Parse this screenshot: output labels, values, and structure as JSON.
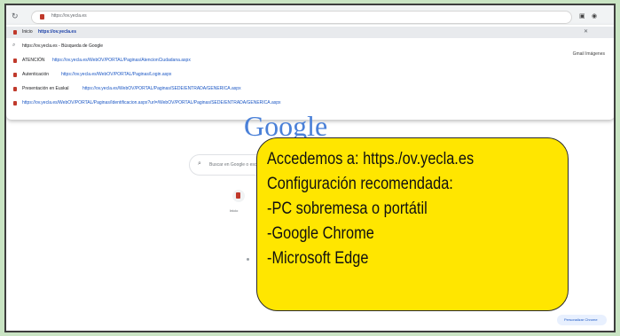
{
  "colors": {
    "background": "#c9e4c3",
    "callout_fill": "#ffe600",
    "link_blue": "#1a56c4",
    "favicon_red": "#c0392b"
  },
  "browser": {
    "omnibox_text": "https://ov.yecla.es",
    "refresh_icon": "refresh-icon"
  },
  "dropdown": {
    "rows": [
      {
        "title": "Inicio",
        "url": "https://ov.yecla.es",
        "selected": true
      },
      {
        "title": "https://ov.yecla.es - Búsqueda de Google",
        "url": "",
        "selected": false,
        "icon": "search-icon"
      },
      {
        "title": "ATENCIÓN",
        "url": "https://ov.yecla.es/WebOV/PORTAL/Paginas/AtencionCiudadana.aspx",
        "selected": false
      },
      {
        "title": "Autenticación",
        "url": "https://ov.yecla.es/WebOV/PORTAL/Paginas/Login.aspx",
        "selected": false
      },
      {
        "title": "Presentación en Euskal",
        "url": "https://ov.yecla.es/WebOV/PORTAL/Paginas/SEDE/ENTRADA/GENERICA.aspx",
        "selected": false
      },
      {
        "title": "",
        "url": "https://ov.yecla.es/WebOV/PORTAL/Paginas/Identificacion.aspx?url=/WebOV/PORTAL/Paginas/SEDE/ENTRADA/GENERICA.aspx",
        "selected": false
      }
    ]
  },
  "google": {
    "logo": "Google",
    "search_placeholder": "Buscar en Google o escribir una URL",
    "shortcut_label": "Inicio",
    "customize_label": "Personalizar Chrome",
    "side_text": "Gmail  Imágenes"
  },
  "callout": {
    "lines": [
      "Accedemos a: https./ov.yecla.es",
      "Configuración recomendada:",
      "-PC sobremesa o portátil",
      "-Google Chrome",
      "-Microsoft Edge"
    ]
  }
}
